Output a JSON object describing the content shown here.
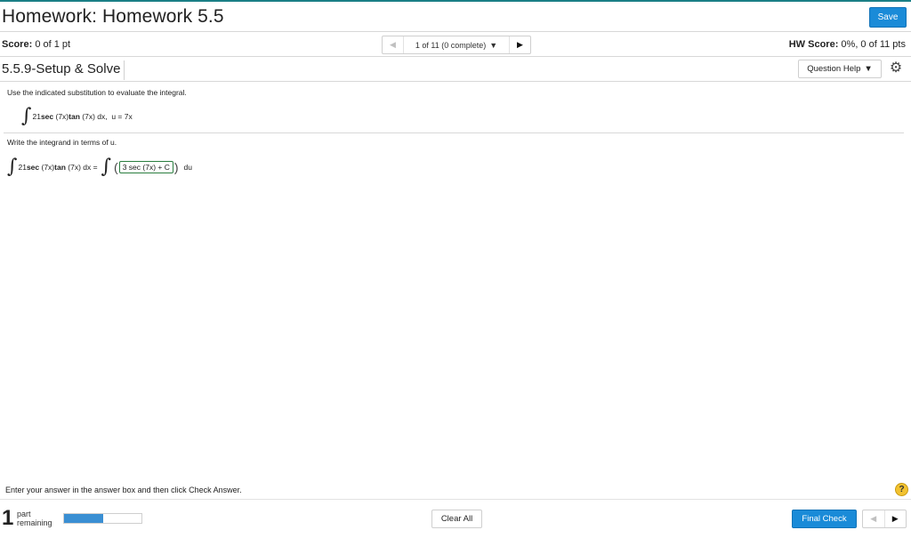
{
  "header": {
    "title": "Homework: Homework 5.5",
    "save_label": "Save"
  },
  "scorebar": {
    "score_label": "Score:",
    "score_value": "0 of 1 pt",
    "nav_text": "1 of 11 (0 complete)",
    "hw_score_label": "HW Score:",
    "hw_score_value": "0%, 0 of 11 pts"
  },
  "question": {
    "title": "5.5.9-Setup & Solve",
    "help_label": "Question Help",
    "prompt": "Use the indicated substitution to evaluate the integral.",
    "integral": {
      "coef": "21",
      "f1": "sec",
      "arg1": "(7x)",
      "f2": "tan",
      "arg2": "(7x) dx,",
      "sub": "u = 7x"
    },
    "prompt2": "Write the integrand in terms of u.",
    "equation": {
      "coef": "21",
      "f1": "sec",
      "arg1": "(7x)",
      "f2": "tan",
      "arg2": "(7x) dx =",
      "answer": "3 sec (7x) + C",
      "du": "du"
    }
  },
  "footer": {
    "instruction": "Enter your answer in the answer box and then click Check Answer.",
    "parts_count": "1",
    "parts_line1": "part",
    "parts_line2": "remaining",
    "progress_fraction": 0.5,
    "clear_label": "Clear All",
    "final_check_label": "Final Check"
  },
  "colors": {
    "accent": "#1a8bd8",
    "answer_border": "#2a7d3f",
    "progress": "#3a8fd3",
    "help": "#f2c230"
  },
  "icons": [
    "gear-icon",
    "help-icon",
    "chevron-down-icon",
    "arrow-left-icon",
    "arrow-right-icon"
  ]
}
